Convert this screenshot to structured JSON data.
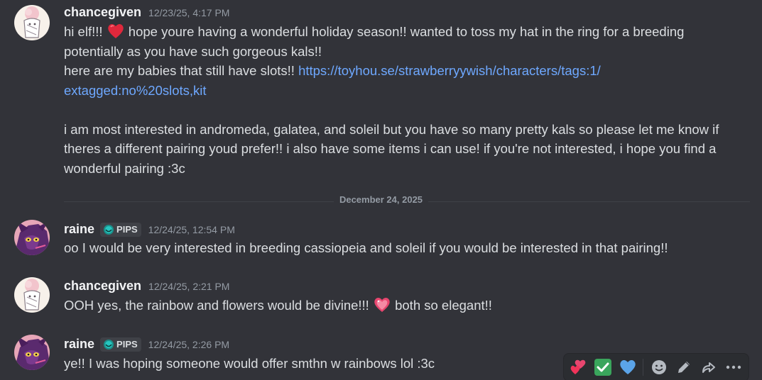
{
  "messages": [
    {
      "username": "chancegiven",
      "timestamp": "12/23/25, 4:17 PM",
      "lines": {
        "p1_a": "hi elf!!! ",
        "p1_b": " hope youre having a wonderful holiday season!! wanted to toss my hat in the ring for a breeding",
        "p1_c": "potentially as you have such gorgeous kals!!",
        "p2_a": "here are my babies that still have slots!! ",
        "link_1": "https://toyhou.se/strawberryywish/characters/tags:1/",
        "link_2": "extagged:no%20slots,kit",
        "p3_a": "i am most interested in andromeda, galatea, and soleil but you have so many pretty kals so please let me know if",
        "p3_b": "theres a different pairing youd prefer!! i also have some items i can use! if you're not interested, i hope you find a",
        "p3_c": "wonderful pairing :3c"
      }
    },
    {
      "username": "raine",
      "tag": "PIPS",
      "timestamp": "12/24/25, 12:54 PM",
      "text": "oo I would be very interested in breeding cassiopeia and soleil if you would be interested in that pairing!!"
    },
    {
      "username": "chancegiven",
      "timestamp": "12/24/25, 2:21 PM",
      "text_a": "OOH yes, the rainbow and flowers would be divine!!! ",
      "text_b": " both so elegant!!"
    },
    {
      "username": "raine",
      "tag": "PIPS",
      "timestamp": "12/24/25, 2:26 PM",
      "text": "ye!! I was hoping someone would offer smthn w rainbows lol :3c"
    }
  ],
  "date_divider": "December 24, 2025",
  "toolbar_icons": [
    "two-hearts-icon",
    "check-mark-icon",
    "blue-heart-icon",
    "emoji-icon",
    "pencil-icon",
    "forward-icon",
    "more-icon"
  ],
  "colors": {
    "background": "#323339",
    "link": "#6ea8ff",
    "username": "#f2f3f5",
    "timestamp": "#949ba4",
    "text": "#dbdee1"
  }
}
